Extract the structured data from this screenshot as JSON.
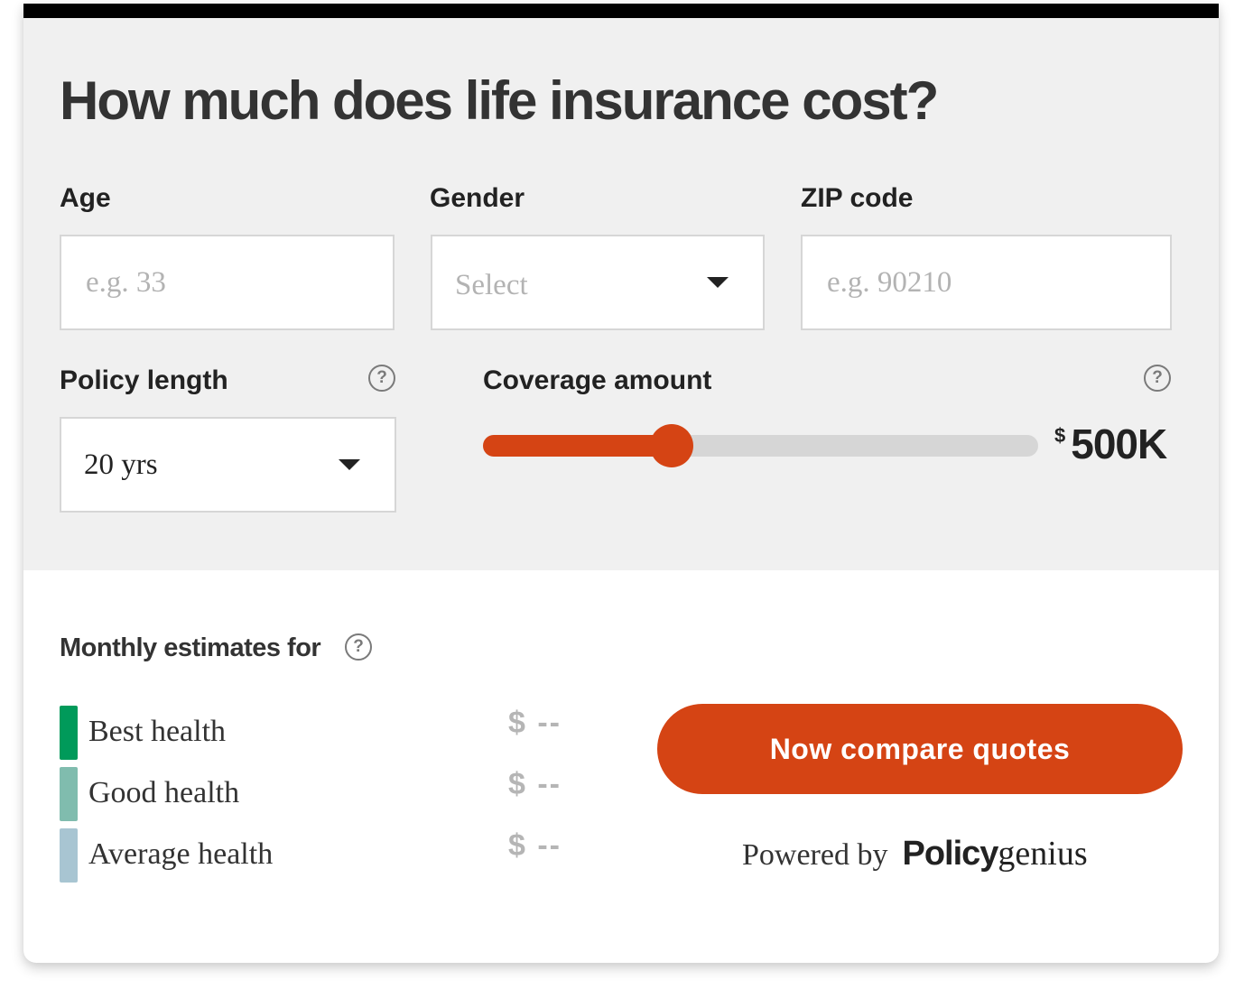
{
  "title": "How much does life insurance cost?",
  "form": {
    "age": {
      "label": "Age",
      "placeholder": "e.g. 33",
      "value": ""
    },
    "gender": {
      "label": "Gender",
      "placeholder": "Select",
      "value": ""
    },
    "zip": {
      "label": "ZIP code",
      "placeholder": "e.g. 90210",
      "value": ""
    },
    "policy_length": {
      "label": "Policy length",
      "value": "20 yrs",
      "help_icon": "question-circle-icon"
    },
    "coverage": {
      "label": "Coverage amount",
      "help_icon": "question-circle-icon",
      "currency_symbol": "$",
      "display_value": "500K",
      "slider_fraction": 0.34
    }
  },
  "estimates": {
    "title": "Monthly estimates for",
    "help_icon": "question-circle-icon",
    "rows": [
      {
        "label": "Best health",
        "price": "$ --",
        "color": "#009a5a"
      },
      {
        "label": "Good health",
        "price": "$ --",
        "color": "#80bcae"
      },
      {
        "label": "Average health",
        "price": "$ --",
        "color": "#a8c5d2"
      }
    ]
  },
  "cta": {
    "label": "Now compare quotes"
  },
  "footer": {
    "powered_by": "Powered by",
    "brand_bold": "Policy",
    "brand_regular": "genius"
  },
  "colors": {
    "accent": "#d54414",
    "panel_bg": "#f0f0f0",
    "top_bar": "#000000"
  }
}
